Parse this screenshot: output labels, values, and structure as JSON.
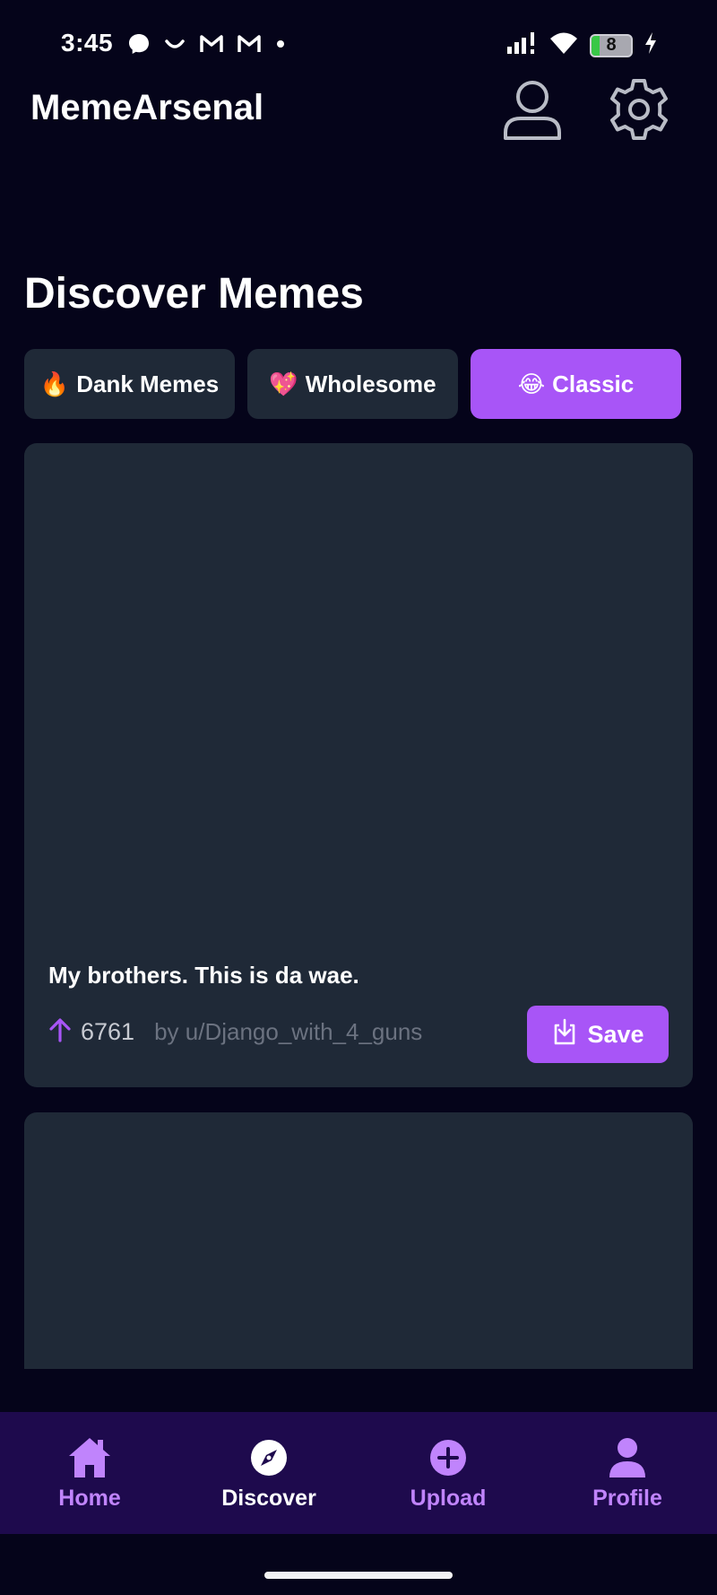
{
  "status_bar": {
    "time": "3:45",
    "battery_level": "8",
    "left_icons": [
      "messenger-icon",
      "smile-icon",
      "gmail-icon",
      "gmail-icon",
      "dot-icon"
    ],
    "right_icons": [
      "signal-icon",
      "wifi-icon",
      "battery-icon",
      "charging-icon"
    ]
  },
  "header": {
    "title": "MemeArsenal",
    "icons": [
      "user-icon",
      "gear-icon"
    ]
  },
  "page": {
    "title": "Discover Memes"
  },
  "categories": [
    {
      "emoji": "🔥",
      "label": "Dank Memes",
      "active": false
    },
    {
      "emoji": "💖",
      "label": "Wholesome",
      "active": false
    },
    {
      "emoji": "😂",
      "label": "Classic",
      "active": true
    }
  ],
  "memes": [
    {
      "title": "My brothers. This is da wae.",
      "upvotes": "6761",
      "author": "by u/Django_with_4_guns",
      "save_label": "Save"
    }
  ],
  "bottom_nav": [
    {
      "label": "Home",
      "icon": "home-icon",
      "active": false
    },
    {
      "label": "Discover",
      "icon": "compass-icon",
      "active": true
    },
    {
      "label": "Upload",
      "icon": "plus-circle-icon",
      "active": false
    },
    {
      "label": "Profile",
      "icon": "profile-icon",
      "active": false
    }
  ],
  "colors": {
    "background": "#05041a",
    "card": "#1f2937",
    "accent": "#a855f7",
    "nav_background": "#1e0a4d",
    "nav_inactive": "#c084fc"
  }
}
